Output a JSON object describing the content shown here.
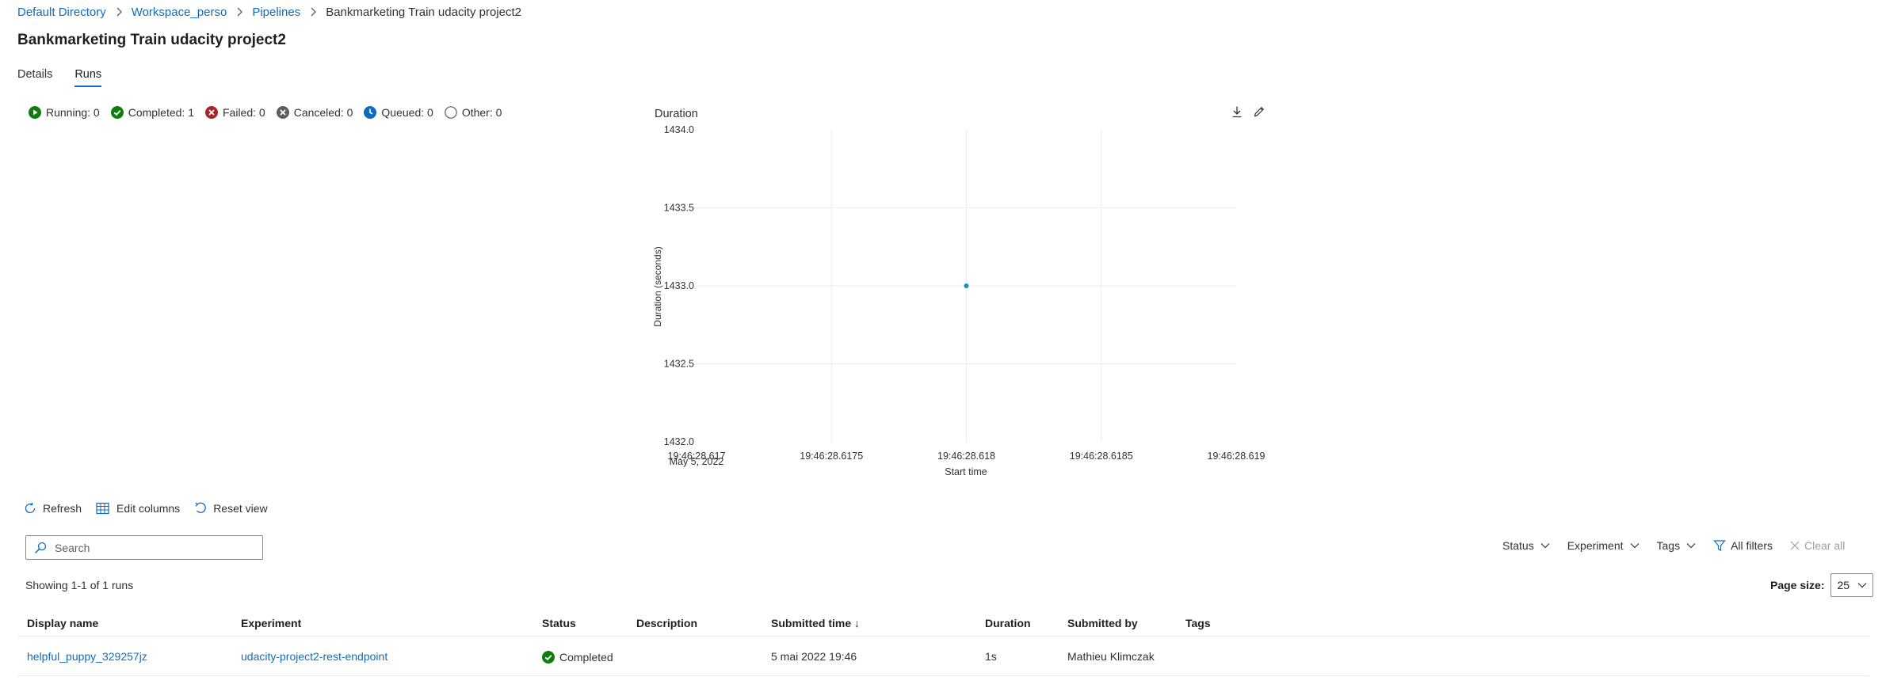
{
  "breadcrumb": {
    "items": [
      "Default Directory",
      "Workspace_perso",
      "Pipelines"
    ],
    "current": "Bankmarketing Train udacity project2"
  },
  "page": {
    "title": "Bankmarketing Train udacity project2"
  },
  "tabs": [
    {
      "label": "Details",
      "active": false
    },
    {
      "label": "Runs",
      "active": true
    }
  ],
  "status_summary": [
    {
      "label": "Running: 0",
      "icon": "running-icon",
      "color": "#107c10"
    },
    {
      "label": "Completed: 1",
      "icon": "completed-icon",
      "color": "#107c10"
    },
    {
      "label": "Failed: 0",
      "icon": "failed-icon",
      "color": "#a4262c"
    },
    {
      "label": "Canceled: 0",
      "icon": "canceled-icon",
      "color": "#605e5c"
    },
    {
      "label": "Queued: 0",
      "icon": "queued-icon",
      "color": "#0f6cbd"
    },
    {
      "label": "Other: 0",
      "icon": "other-icon",
      "color": "#605e5c"
    }
  ],
  "chart_data": {
    "type": "scatter",
    "title": "Duration",
    "xlabel": "Start time",
    "ylabel": "Duration (seconds)",
    "ylim": [
      1432.0,
      1434.0
    ],
    "yticks": [
      "1434.0",
      "1433.5",
      "1433.0",
      "1432.5",
      "1432.0"
    ],
    "xticks": [
      "19:46:28.617",
      "19:46:28.6175",
      "19:46:28.618",
      "19:46:28.6185",
      "19:46:28.619"
    ],
    "x_date_label": "May 5, 2022",
    "grid": true,
    "points": [
      {
        "x": "19:46:28.618",
        "y": 1433.0
      }
    ],
    "point_color": "#0f8fc4"
  },
  "toolbar": {
    "refresh": "Refresh",
    "edit_columns": "Edit columns",
    "reset_view": "Reset view"
  },
  "search": {
    "placeholder": "Search"
  },
  "filters": {
    "status": "Status",
    "experiment": "Experiment",
    "tags": "Tags",
    "all_filters": "All filters",
    "clear_all": "Clear all"
  },
  "summary": {
    "showing": "Showing 1-1 of 1 runs"
  },
  "pagination": {
    "label": "Page size:",
    "value": "25"
  },
  "table": {
    "columns": [
      "Display name",
      "Experiment",
      "Status",
      "Description",
      "Submitted time ↓",
      "Duration",
      "Submitted by",
      "Tags"
    ],
    "rows": [
      {
        "display_name": "helpful_puppy_329257jz",
        "experiment": "udacity-project2-rest-endpoint",
        "status": "Completed",
        "description": "",
        "submitted_time": "5 mai 2022 19:46",
        "duration": "1s",
        "submitted_by": "Mathieu Klimczak",
        "tags": ""
      }
    ]
  }
}
